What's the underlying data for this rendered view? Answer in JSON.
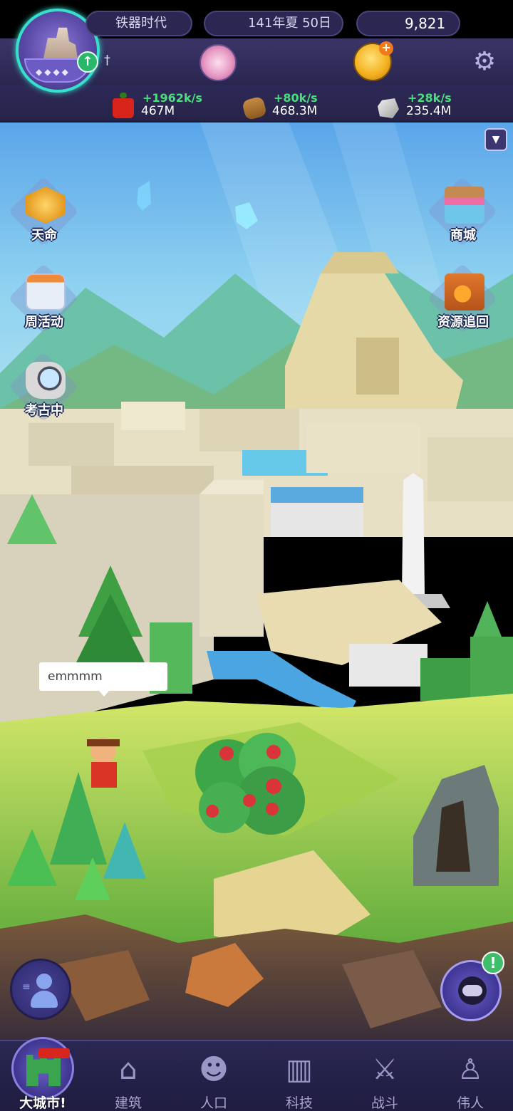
{
  "hud": {
    "era_label": "铁器时代",
    "date_label": "141年夏 50日",
    "gold_amount": "9,821",
    "resources": [
      {
        "name": "food",
        "rate": "+1962k/s",
        "amount": "467M"
      },
      {
        "name": "wood",
        "rate": "+80k/s",
        "amount": "468.3M"
      },
      {
        "name": "stone",
        "rate": "+28k/s",
        "amount": "235.4M"
      }
    ]
  },
  "side_buttons": {
    "destiny": "天命",
    "weekly_events": "周活动",
    "archaeology": "考古中",
    "shop": "商城",
    "resource_recovery": "资源追回"
  },
  "speech_bubble": "emmmm",
  "alert_badge": "!",
  "bottom_nav": [
    {
      "label": "大城市!",
      "icon": "castle-icon",
      "active": true
    },
    {
      "label": "建筑",
      "icon": "house-icon",
      "active": false
    },
    {
      "label": "人口",
      "icon": "person-icon",
      "active": false
    },
    {
      "label": "科技",
      "icon": "book-icon",
      "active": false
    },
    {
      "label": "战斗",
      "icon": "crossed-swords-icon",
      "active": false
    },
    {
      "label": "伟人",
      "icon": "statue-icon",
      "active": false
    }
  ],
  "colors": {
    "hud_bg": "#2e2a58",
    "rate_green": "#48e07a",
    "avatar_ring": "#36e0cc",
    "nav_bg": "#1f1c40"
  }
}
